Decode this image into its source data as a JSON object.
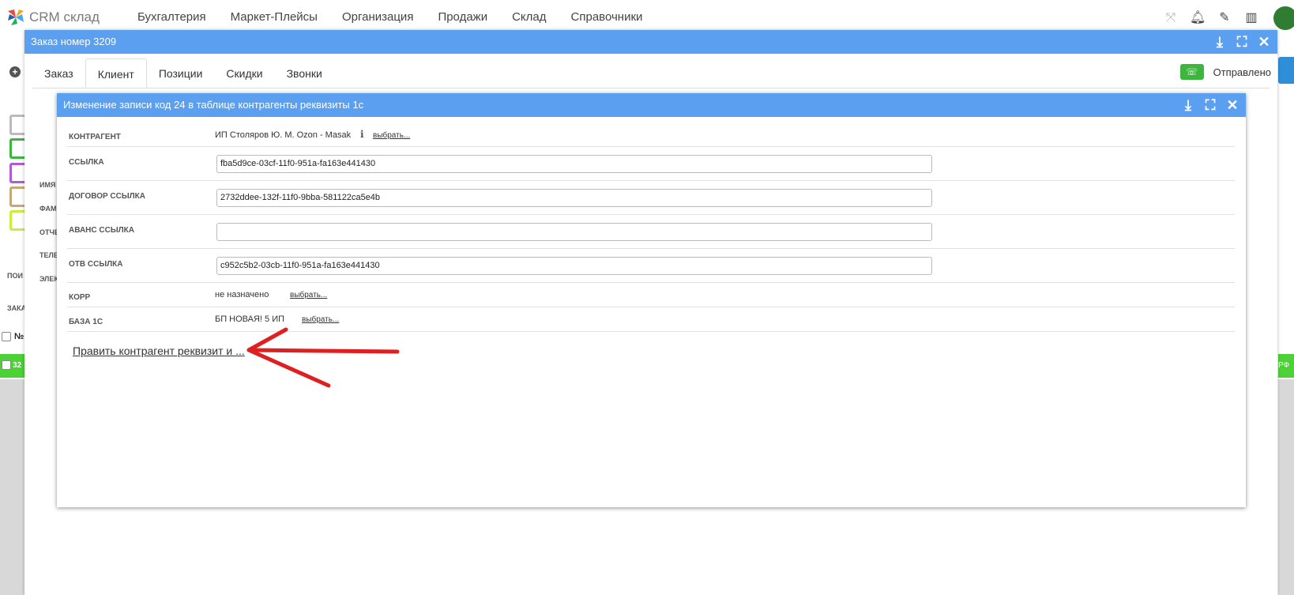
{
  "app": {
    "name": "CRM склад"
  },
  "nav": [
    "Бухгалтерия",
    "Маркет-Плейсы",
    "Организация",
    "Продажи",
    "Склад",
    "Справочники"
  ],
  "order_window": {
    "title": "Заказ номер 3209",
    "tabs": [
      "Заказ",
      "Клиент",
      "Позиции",
      "Скидки",
      "Звонки"
    ],
    "active_tab": "Клиент",
    "status": "Отправлено"
  },
  "dialog": {
    "title": "Изменение записи код 24 в таблице контрагенты реквизиты 1с",
    "fields": {
      "kontragent": {
        "label": "КОНТРАГЕНТ",
        "value": "ИП Столяров Ю. М. Ozon - Masak",
        "link": "выбрать..."
      },
      "ssylka": {
        "label": "ССЫЛКА",
        "value": "fba5d9ce-03cf-11f0-951a-fa163e441430"
      },
      "dogovor": {
        "label": "ДОГОВОР ССЫЛКА",
        "value": "2732ddee-132f-11f0-9bba-581122ca5e4b"
      },
      "avans": {
        "label": "АВАНС ССЫЛКА",
        "value": ""
      },
      "otv": {
        "label": "ОТВ ССЫЛКА",
        "value": "c952c5b2-03cb-11f0-951a-fa163e441430"
      },
      "korr": {
        "label": "КОРР",
        "value": "не назначено",
        "link": "выбрать..."
      },
      "baza": {
        "label": "БАЗА 1С",
        "value": "БП НОВАЯ! 5 ИП",
        "link": "выбрать..."
      }
    },
    "edit_link": "Править контрагент реквизит и ..."
  },
  "background": {
    "labels": [
      "ИМЯ",
      "ФАМ",
      "ОТЧЕ",
      "ТЕЛЕ",
      "ЭЛЕК",
      "ПОИ",
      "ЗАКА",
      "№",
      "32",
      "РФ"
    ]
  },
  "colors": {
    "title_bar": "#5b9ff0",
    "status_green": "#3db63d",
    "annotation_arrow": "#e02020"
  },
  "icons": [
    "crm-logo-icon",
    "scan-icon",
    "bell-icon",
    "edit-icon",
    "barcode-icon",
    "download-icon",
    "maximize-icon",
    "close-icon",
    "phone-icon",
    "info-icon",
    "plus-circle-icon"
  ]
}
